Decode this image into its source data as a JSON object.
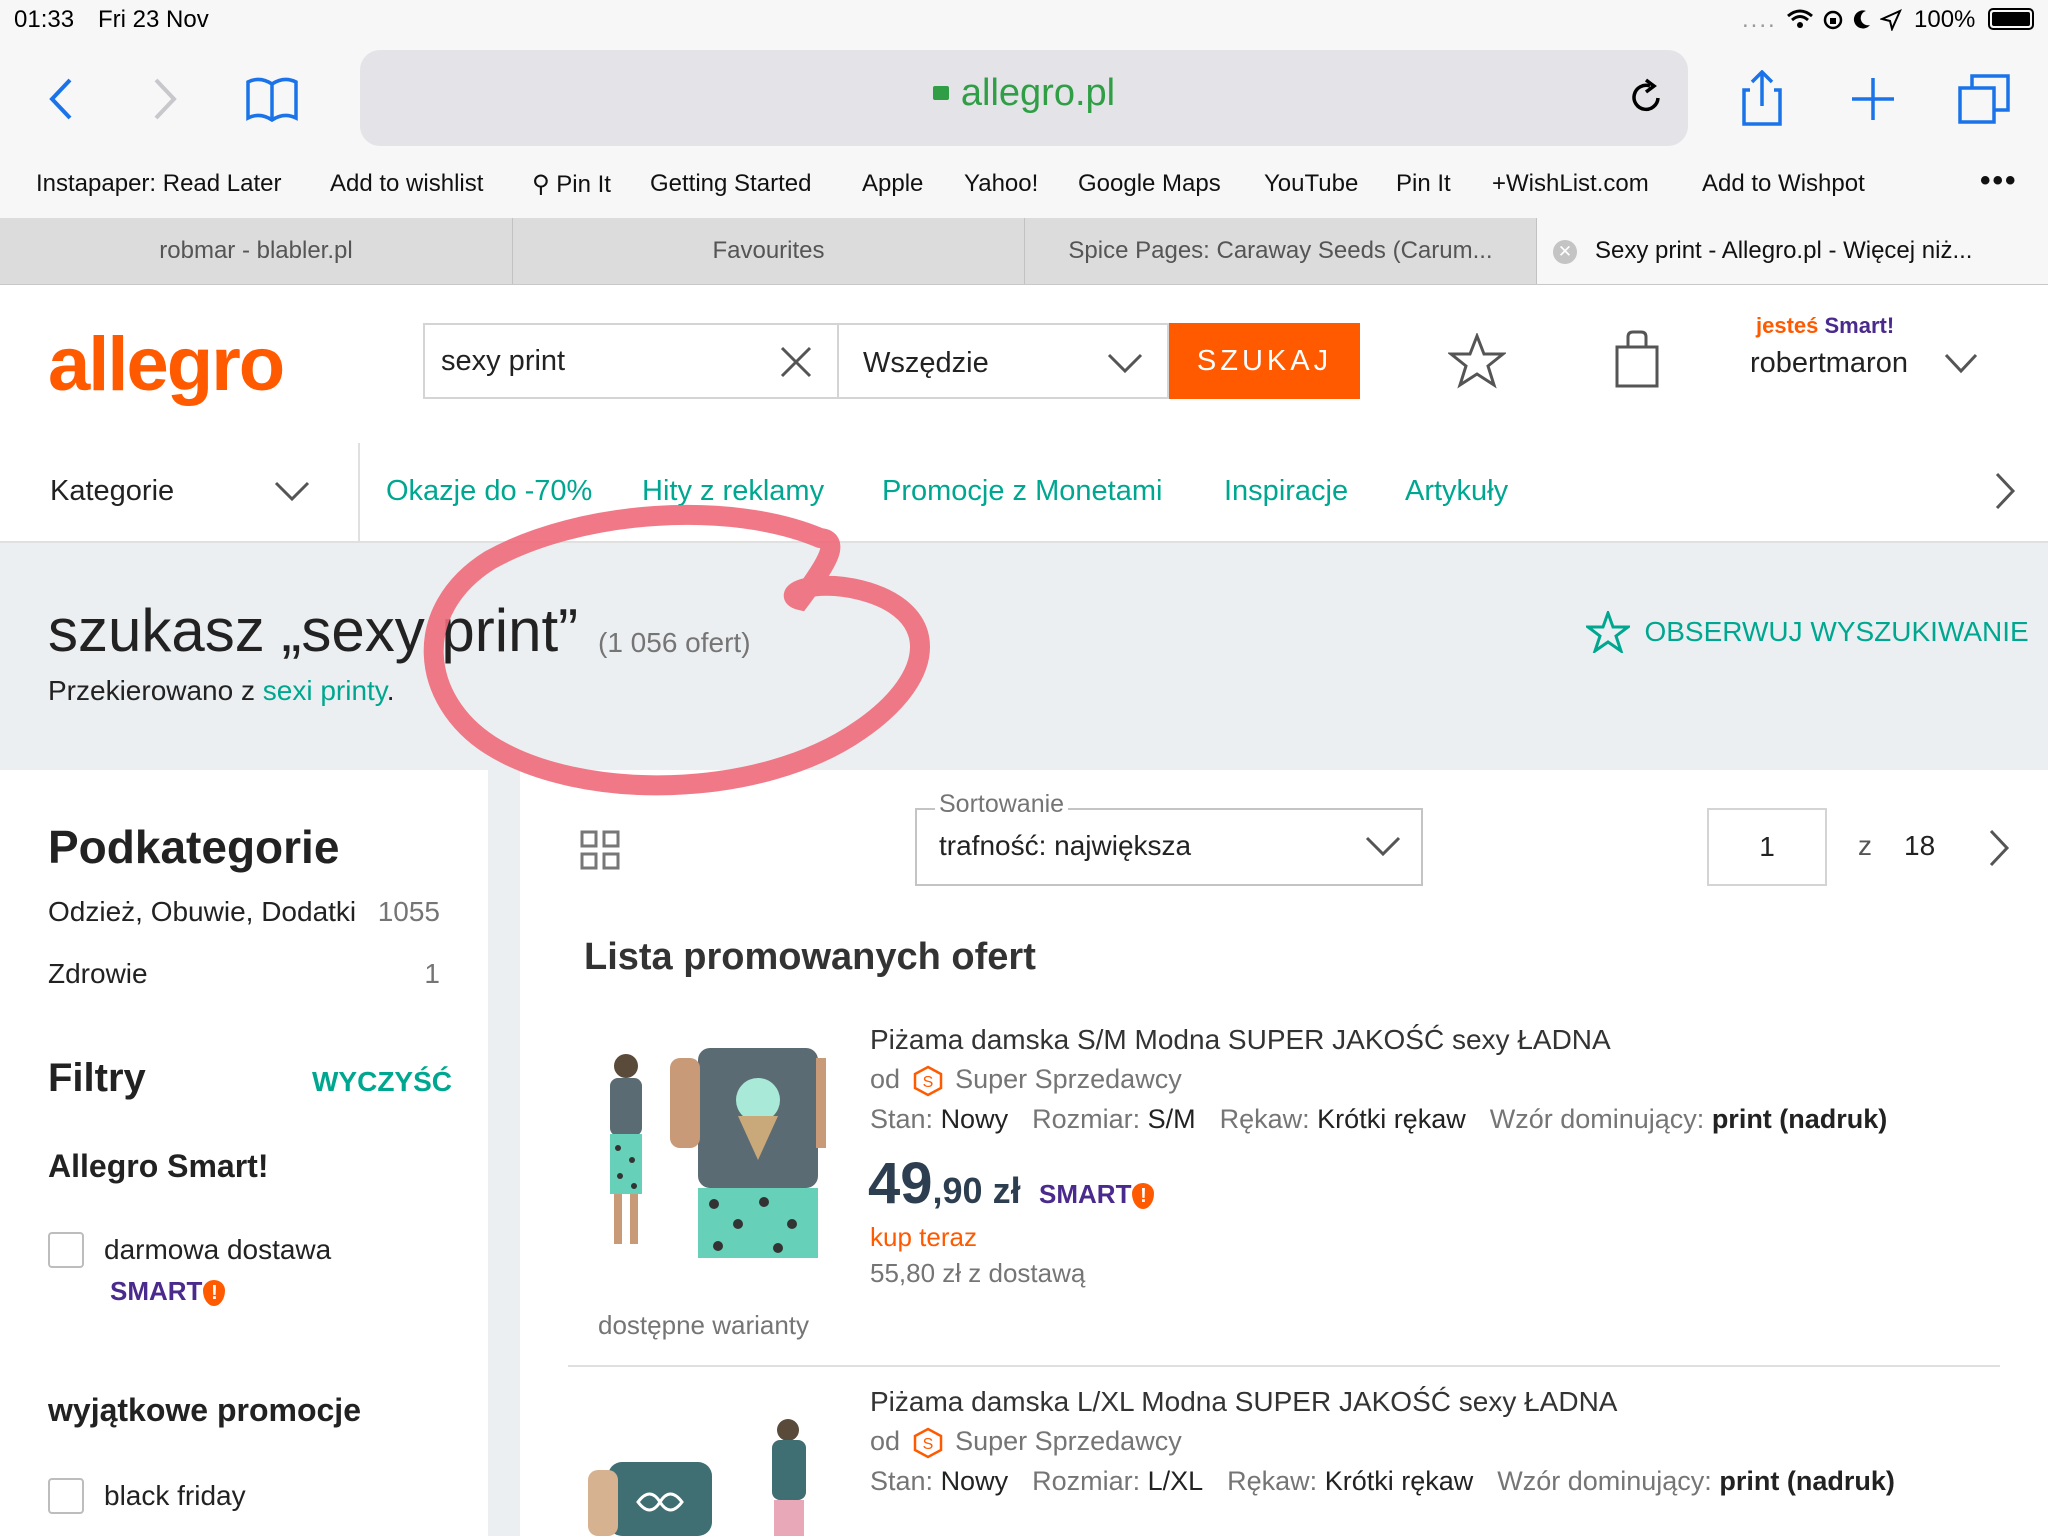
{
  "status": {
    "time": "01:33",
    "date": "Fri 23 Nov",
    "battery": "100%"
  },
  "browser": {
    "url": "allegro.pl",
    "bookmarks": [
      "Instapaper: Read Later",
      "Add to wishlist",
      "⚲ Pin It",
      "Getting Started",
      "Apple",
      "Yahoo!",
      "Google Maps",
      "YouTube",
      "Pin It",
      "+WishList.com",
      "Add to Wishpot"
    ],
    "tabs": [
      "robmar - blabler.pl",
      "Favourites",
      "Spice Pages: Caraway Seeds (Carum...",
      "Sexy print - Allegro.pl - Więcej niż..."
    ]
  },
  "header": {
    "logo": "allegro",
    "search_value": "sexy print",
    "scope": "Wszędzie",
    "search_button": "SZUKAJ",
    "smart_prefix": "jesteś ",
    "smart_label": "Smart!",
    "username": "robertmaron"
  },
  "nav": {
    "categories": "Kategorie",
    "links": [
      "Okazje do -70%",
      "Hity z reklamy",
      "Promocje z Monetami",
      "Inspiracje",
      "Artykuły"
    ]
  },
  "summary": {
    "title": "szukasz „sexy print”",
    "count": "(1 056 ofert)",
    "redirect_prefix": "Przekierowano z ",
    "redirect_link": "sexi printy",
    "redirect_suffix": ".",
    "watch": "OBSERWUJ WYSZUKIWANIE"
  },
  "sidebar": {
    "subcategories_title": "Podkategorie",
    "subcategories": [
      {
        "name": "Odzież, Obuwie, Dodatki",
        "count": "1055"
      },
      {
        "name": "Zdrowie",
        "count": "1"
      }
    ],
    "filters_title": "Filtry",
    "clear": "WYCZYŚĆ",
    "smart_title": "Allegro Smart!",
    "free_delivery": "darmowa dostawa",
    "smart_badge": "SMART",
    "promo_title": "wyjątkowe promocje",
    "black_friday": "black friday"
  },
  "listing": {
    "sort_label": "Sortowanie",
    "sort_value": "trafność: największa",
    "page": "1",
    "page_of": "z",
    "page_total": "18",
    "promoted_title": "Lista promowanych ofert",
    "items": [
      {
        "title": "Piżama damska S/M Modna SUPER JAKOŚĆ sexy ŁADNA",
        "from": "od",
        "seller": "Super Sprzedawcy",
        "condition_label": "Stan:",
        "condition": "Nowy",
        "size_label": "Rozmiar:",
        "size": "S/M",
        "sleeve_label": "Rękaw:",
        "sleeve": "Krótki rękaw",
        "pattern_label": "Wzór dominujący:",
        "pattern": "print (nadruk)",
        "price_main": "49",
        "price_rest": ",90 zł",
        "buy": "kup teraz",
        "delivery": "55,80 zł z dostawą",
        "variants": "dostępne warianty"
      },
      {
        "title": "Piżama damska L/XL Modna SUPER JAKOŚĆ sexy ŁADNA",
        "from": "od",
        "seller": "Super Sprzedawcy",
        "condition_label": "Stan:",
        "condition": "Nowy",
        "size_label": "Rozmiar:",
        "size": "L/XL",
        "sleeve_label": "Rękaw:",
        "sleeve": "Krótki rękaw",
        "pattern_label": "Wzór dominujący:",
        "pattern": "print (nadruk)"
      }
    ]
  },
  "colors": {
    "allegro_orange": "#ff5a00",
    "allegro_green": "#00a790",
    "smart_purple": "#4a2a8c",
    "annotation": "#f06a7a"
  }
}
